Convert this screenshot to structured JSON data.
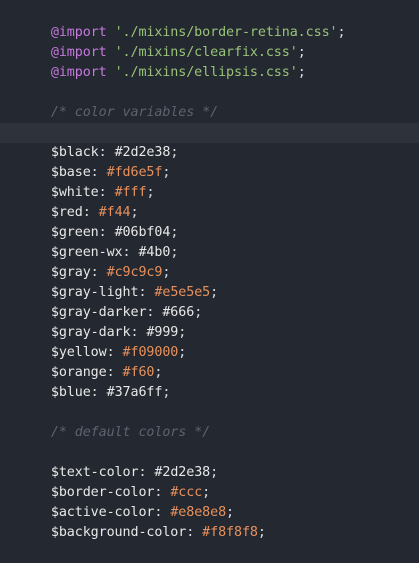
{
  "imports": [
    {
      "keyword": "@import",
      "path": "'./mixins/border-retina.css'",
      "end": ";"
    },
    {
      "keyword": "@import",
      "path": "'./mixins/clearfix.css'",
      "end": ";"
    },
    {
      "keyword": "@import",
      "path": "'./mixins/ellipsis.css'",
      "end": ";"
    }
  ],
  "comments": {
    "color_variables": "/* color variables */",
    "default_colors": "/* default colors */"
  },
  "color_variables": [
    {
      "name": "$black",
      "colon": ":",
      "value": "#2d2e38",
      "end": ";",
      "highlight": false
    },
    {
      "name": "$base",
      "colon": ":",
      "value": "#fd6e5f",
      "end": ";",
      "highlight": true
    },
    {
      "name": "$white",
      "colon": ":",
      "value": "#fff",
      "end": ";",
      "highlight": true
    },
    {
      "name": "$red",
      "colon": ":",
      "value": "#f44",
      "end": ";",
      "highlight": true
    },
    {
      "name": "$green",
      "colon": ":",
      "value": "#06bf04",
      "end": ";",
      "highlight": false
    },
    {
      "name": "$green-wx",
      "colon": ":",
      "value": "#4b0",
      "end": ";",
      "highlight": false
    },
    {
      "name": "$gray",
      "colon": ":",
      "value": "#c9c9c9",
      "end": ";",
      "highlight": true
    },
    {
      "name": "$gray-light",
      "colon": ":",
      "value": "#e5e5e5",
      "end": ";",
      "highlight": true
    },
    {
      "name": "$gray-darker",
      "colon": ":",
      "value": "#666",
      "end": ";",
      "highlight": false
    },
    {
      "name": "$gray-dark",
      "colon": ":",
      "value": "#999",
      "end": ";",
      "highlight": false
    },
    {
      "name": "$yellow",
      "colon": ":",
      "value": "#f09000",
      "end": ";",
      "highlight": true
    },
    {
      "name": "$orange",
      "colon": ":",
      "value": "#f60",
      "end": ";",
      "highlight": true
    },
    {
      "name": "$blue",
      "colon": ":",
      "value": "#37a6ff",
      "end": ";",
      "highlight": false
    }
  ],
  "default_colors": [
    {
      "name": "$text-color",
      "colon": ":",
      "value": "#2d2e38",
      "end": ";",
      "highlight": false
    },
    {
      "name": "$border-color",
      "colon": ":",
      "value": "#ccc",
      "end": ";",
      "highlight": true
    },
    {
      "name": "$active-color",
      "colon": ":",
      "value": "#e8e8e8",
      "end": ";",
      "highlight": true
    },
    {
      "name": "$background-color",
      "colon": ":",
      "value": "#f8f8f8",
      "end": ";",
      "highlight": true
    }
  ],
  "colors": {
    "background": "#242830",
    "active_line": "#2d323b",
    "keyword": "#c678dd",
    "string": "#98c379",
    "comment": "#5c6370",
    "variable": "#e8e8e8",
    "highlight_literal": "#e8915c"
  }
}
